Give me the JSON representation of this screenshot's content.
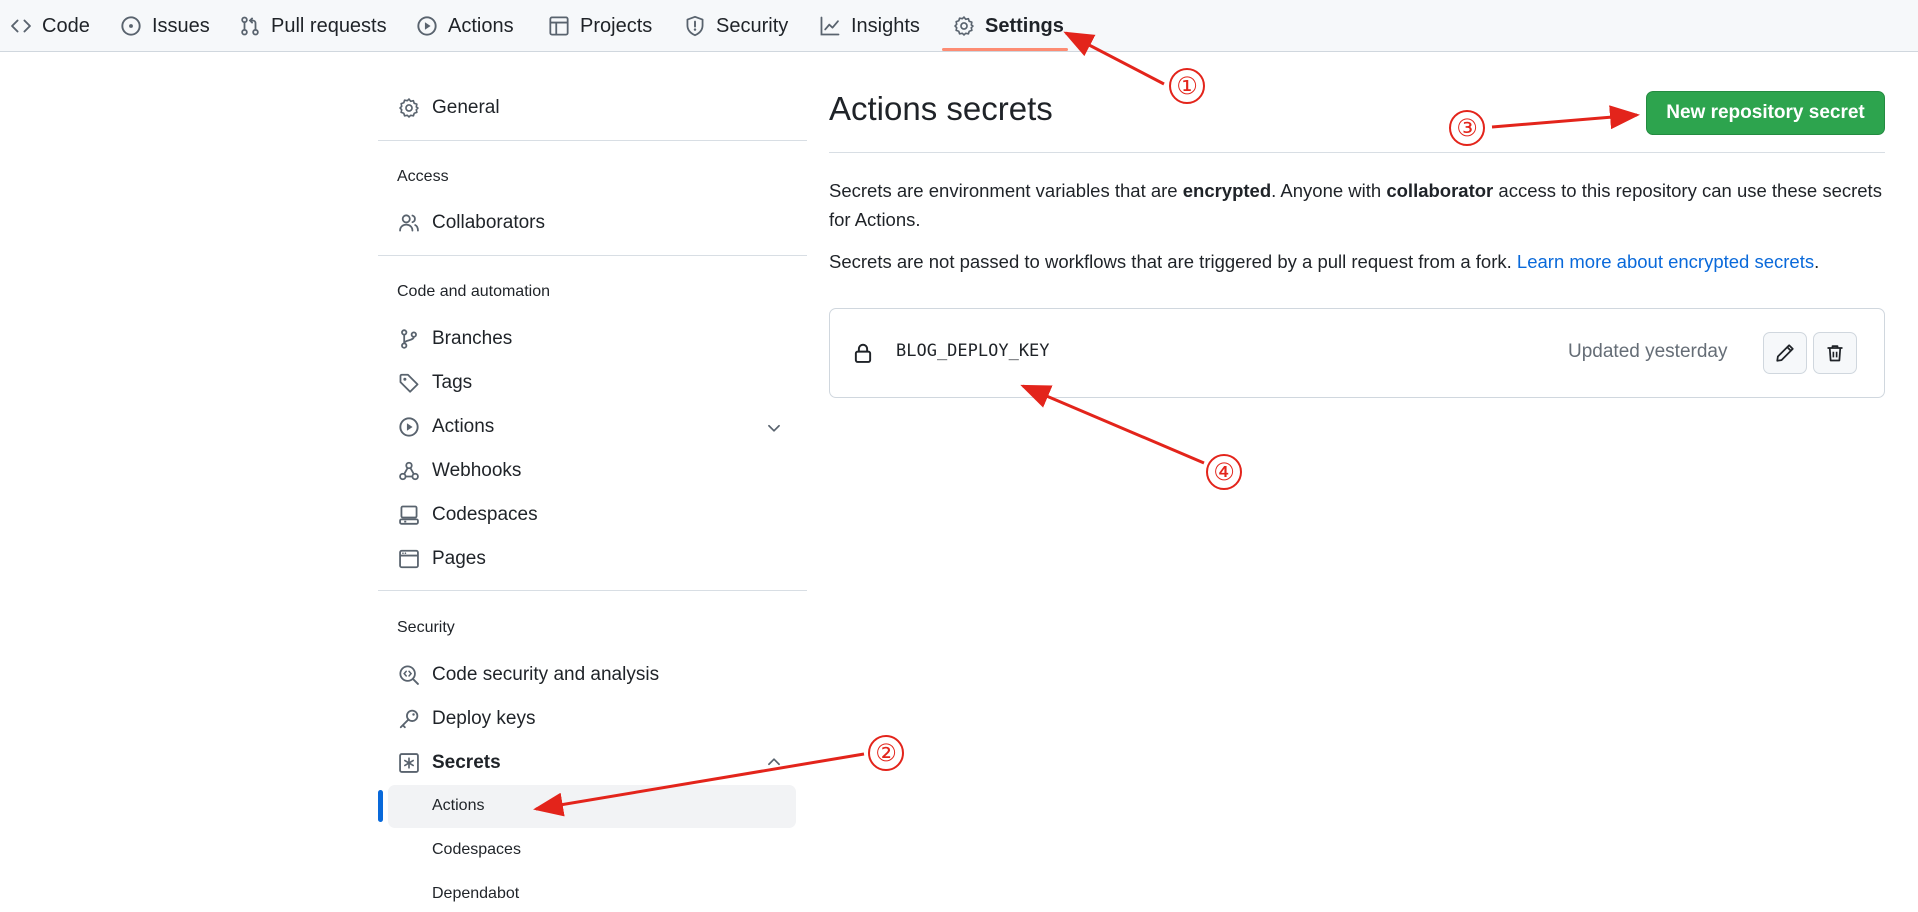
{
  "topnav": {
    "tabs": [
      {
        "label": "Code",
        "icon": "code-icon"
      },
      {
        "label": "Issues",
        "icon": "issue-icon"
      },
      {
        "label": "Pull requests",
        "icon": "pull-request-icon"
      },
      {
        "label": "Actions",
        "icon": "play-icon"
      },
      {
        "label": "Projects",
        "icon": "table-icon"
      },
      {
        "label": "Security",
        "icon": "shield-icon"
      },
      {
        "label": "Insights",
        "icon": "graph-icon"
      },
      {
        "label": "Settings",
        "icon": "gear-icon",
        "selected": true
      }
    ]
  },
  "sidebar": {
    "general": "General",
    "access_heading": "Access",
    "collaborators": "Collaborators",
    "code_heading": "Code and automation",
    "branches": "Branches",
    "tags": "Tags",
    "actions": "Actions",
    "webhooks": "Webhooks",
    "codespaces": "Codespaces",
    "pages": "Pages",
    "security_heading": "Security",
    "code_security": "Code security and analysis",
    "deploy_keys": "Deploy keys",
    "secrets": "Secrets",
    "secrets_sub": [
      "Actions",
      "Codespaces",
      "Dependabot"
    ]
  },
  "main": {
    "title": "Actions secrets",
    "new_button": "New repository secret",
    "para1": {
      "t1": "Secrets are environment variables that are ",
      "b1": "encrypted",
      "t2": ". Anyone with ",
      "b2": "collaborator",
      "t3": " access to this repository can use these secrets for Actions."
    },
    "para2": {
      "text": "Secrets are not passed to workflows that are triggered by a pull request from a fork. ",
      "link": "Learn more about encrypted secrets",
      "end": "."
    },
    "secrets": [
      {
        "name": "BLOG_DEPLOY_KEY",
        "updated": "Updated yesterday"
      }
    ]
  },
  "annotations": {
    "markers": [
      "①",
      "②",
      "③",
      "④"
    ],
    "color": "#e3241b"
  },
  "colors": {
    "accent_green": "#2da44e",
    "link_blue": "#0969da",
    "tab_underline": "#fd8c73",
    "active_bar": "#0969da"
  }
}
